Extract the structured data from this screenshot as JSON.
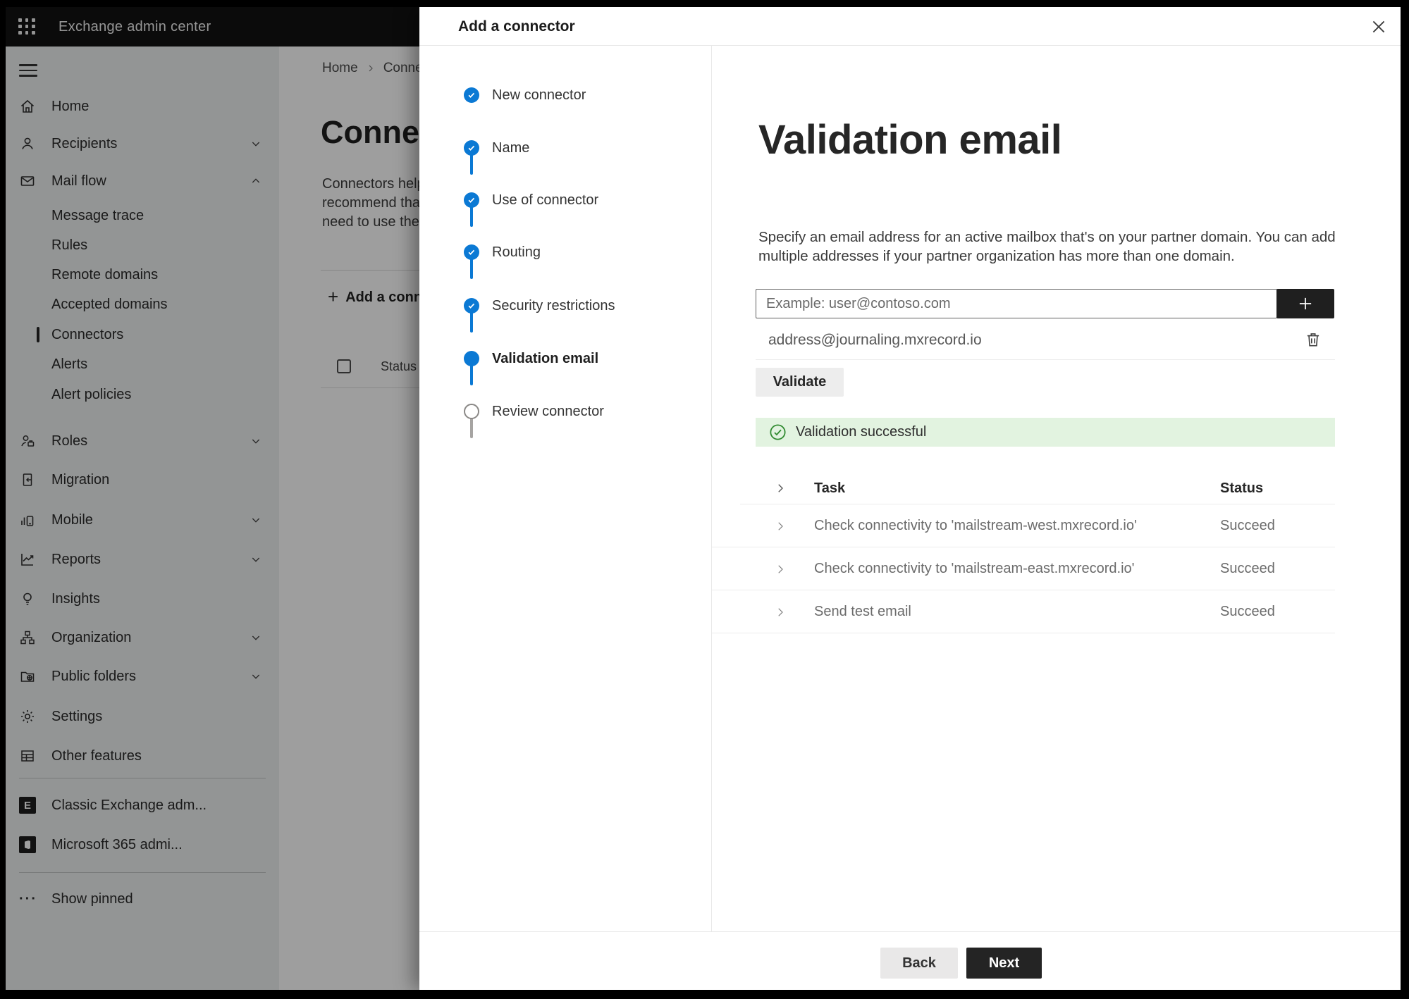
{
  "topbar": {
    "title": "Exchange admin center"
  },
  "sidebar": {
    "items": [
      {
        "label": "Home"
      },
      {
        "label": "Recipients"
      },
      {
        "label": "Mail flow"
      },
      {
        "label": "Message trace"
      },
      {
        "label": "Rules"
      },
      {
        "label": "Remote domains"
      },
      {
        "label": "Accepted domains"
      },
      {
        "label": "Connectors"
      },
      {
        "label": "Alerts"
      },
      {
        "label": "Alert policies"
      },
      {
        "label": "Roles"
      },
      {
        "label": "Migration"
      },
      {
        "label": "Mobile"
      },
      {
        "label": "Reports"
      },
      {
        "label": "Insights"
      },
      {
        "label": "Organization"
      },
      {
        "label": "Public folders"
      },
      {
        "label": "Settings"
      },
      {
        "label": "Other features"
      }
    ],
    "classic_exchange": "Classic Exchange adm...",
    "m365_admin": "Microsoft 365 admi...",
    "show_pinned": "Show pinned"
  },
  "page": {
    "breadcrumb_home": "Home",
    "breadcrumb_current": "Connectors",
    "title": "Connectors",
    "para_line1": "Connectors help",
    "para_line2": "recommend that",
    "para_line3": "need to use ther",
    "add_button": "Add a connector",
    "status_header": "Status"
  },
  "modal": {
    "title": "Add a connector",
    "steps": [
      {
        "label": "New connector",
        "state": "done"
      },
      {
        "label": "Name",
        "state": "done"
      },
      {
        "label": "Use of connector",
        "state": "done"
      },
      {
        "label": "Routing",
        "state": "done"
      },
      {
        "label": "Security restrictions",
        "state": "done"
      },
      {
        "label": "Validation email",
        "state": "current"
      },
      {
        "label": "Review connector",
        "state": "todo"
      }
    ],
    "content": {
      "heading": "Validation email",
      "description": "Specify an email address for an active mailbox that's on your partner domain. You can add multiple addresses if your partner organization has more than one domain.",
      "input_placeholder": "Example: user@contoso.com",
      "added_address": "address@journaling.mxrecord.io",
      "validate_button": "Validate",
      "success_message": "Validation successful",
      "table": {
        "col_task": "Task",
        "col_status": "Status",
        "rows": [
          {
            "task": "Check connectivity to 'mailstream-west.mxrecord.io'",
            "status": "Succeed"
          },
          {
            "task": "Check connectivity to 'mailstream-east.mxrecord.io'",
            "status": "Succeed"
          },
          {
            "task": "Send test email",
            "status": "Succeed"
          }
        ]
      }
    },
    "footer": {
      "back": "Back",
      "next": "Next"
    }
  },
  "colors": {
    "accent_blue": "#0b79d4",
    "success_bg": "#e2f3e0",
    "success_green": "#2f8a2f",
    "primary_button": "#242424"
  }
}
